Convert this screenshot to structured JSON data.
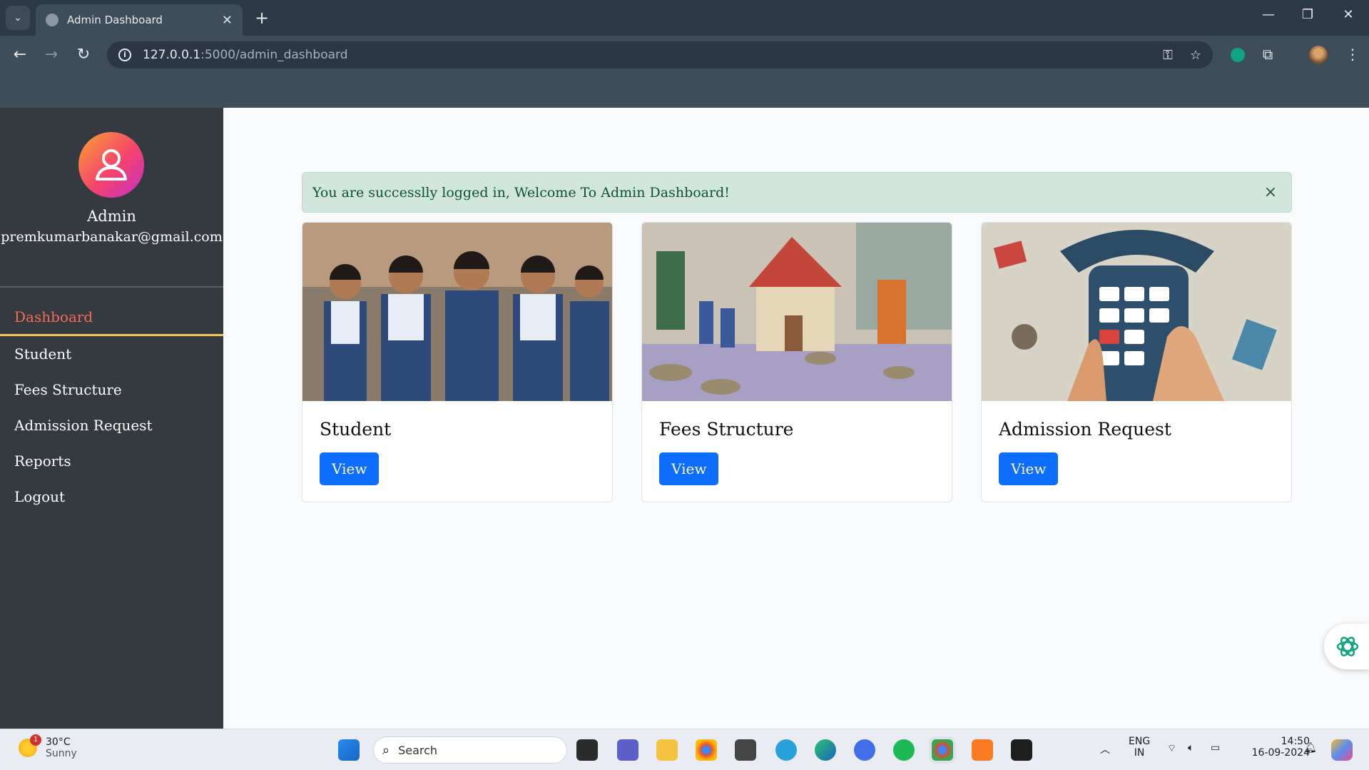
{
  "browser": {
    "tab_title": "Admin Dashboard",
    "url_host": "127.0.0.1",
    "url_path": ":5000/admin_dashboard"
  },
  "sidebar": {
    "user_name": "Admin",
    "user_email": "premkumarbanakar@gmail.com",
    "items": [
      {
        "label": "Dashboard",
        "active": true
      },
      {
        "label": "Student"
      },
      {
        "label": "Fees Structure"
      },
      {
        "label": "Admission Request"
      },
      {
        "label": "Reports"
      },
      {
        "label": "Logout"
      }
    ]
  },
  "alert": {
    "message": "You are successlly logged in, Welcome To Admin Dashboard!",
    "close_symbol": "×"
  },
  "cards": [
    {
      "title": "Student",
      "button": "View"
    },
    {
      "title": "Fees Structure",
      "button": "View"
    },
    {
      "title": "Admission Request",
      "button": "View"
    }
  ],
  "taskbar": {
    "weather_temp": "30°C",
    "weather_condition": "Sunny",
    "weather_badge": "1",
    "search_placeholder": "Search",
    "language": "ENG",
    "region": "IN",
    "time": "14:50",
    "date": "16-09-2024"
  },
  "colors": {
    "sidebar_bg": "#343a40",
    "active_item": "#f36d57",
    "active_underline": "#f2c94c",
    "primary_button": "#0d6efd",
    "alert_bg": "#d1e7dd",
    "alert_text": "#0f5132"
  }
}
